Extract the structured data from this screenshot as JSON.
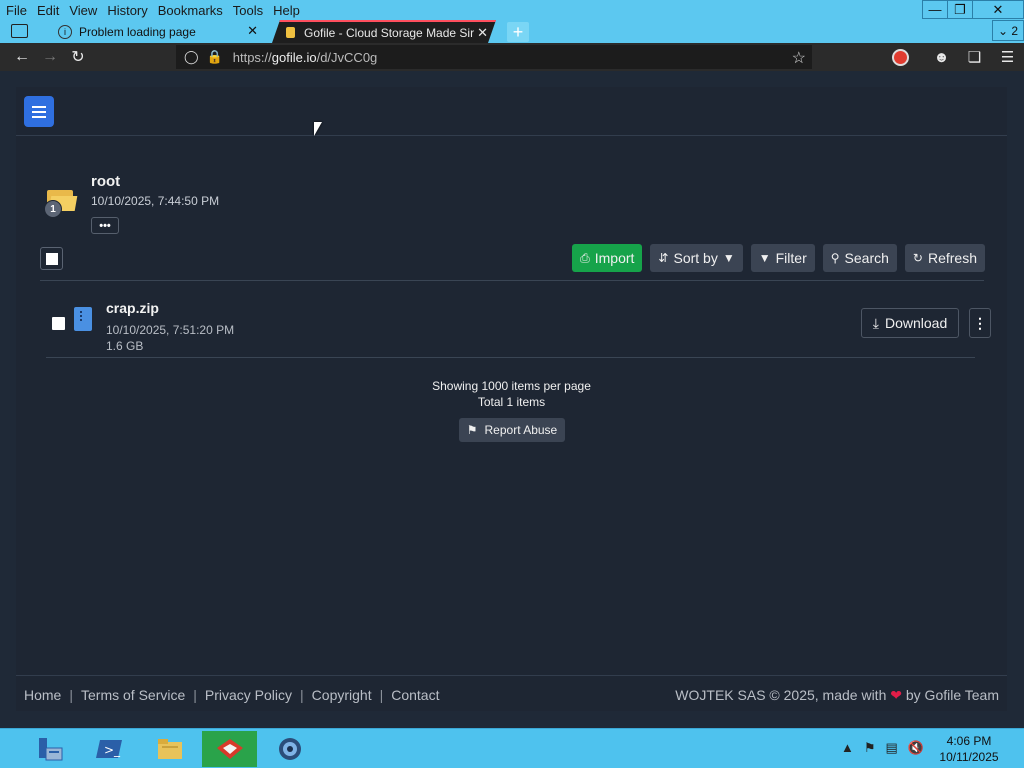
{
  "browser": {
    "menu": [
      "File",
      "Edit",
      "View",
      "History",
      "Bookmarks",
      "Tools",
      "Help"
    ],
    "tabs": [
      {
        "title": "Problem loading page",
        "active": false
      },
      {
        "title": "Gofile - Cloud Storage Made Sir",
        "active": true
      }
    ],
    "tab_count": "2",
    "url_prefix": "https://",
    "url_host": "gofile.io",
    "url_path": "/d/JvCC0g"
  },
  "folder": {
    "name": "root",
    "date": "10/10/2025, 7:44:50 PM",
    "badge_count": "1",
    "more": "•••"
  },
  "toolbar": {
    "import_label": "Import",
    "sortby_label": "Sort by",
    "filter_label": "Filter",
    "search_label": "Search",
    "refresh_label": "Refresh"
  },
  "files": [
    {
      "name": "crap.zip",
      "date": "10/10/2025, 7:51:20 PM",
      "size": "1.6 GB",
      "download_label": "Download"
    }
  ],
  "listing": {
    "per_page": "Showing 1000 items per page",
    "total": "Total 1 items",
    "report_label": "Report Abuse"
  },
  "footer": {
    "links": [
      "Home",
      "Terms of Service",
      "Privacy Policy",
      "Copyright",
      "Contact"
    ],
    "copyright_prefix": "WOJTEK SAS © 2025, made with",
    "copyright_suffix": "by Gofile Team"
  },
  "taskbar": {
    "time": "4:06 PM",
    "date": "10/11/2025"
  },
  "colors": {
    "accent_blue": "#2f6fe0",
    "import_green": "#16a34a",
    "page_bg": "#1f2937",
    "heart": "#e11d48"
  }
}
